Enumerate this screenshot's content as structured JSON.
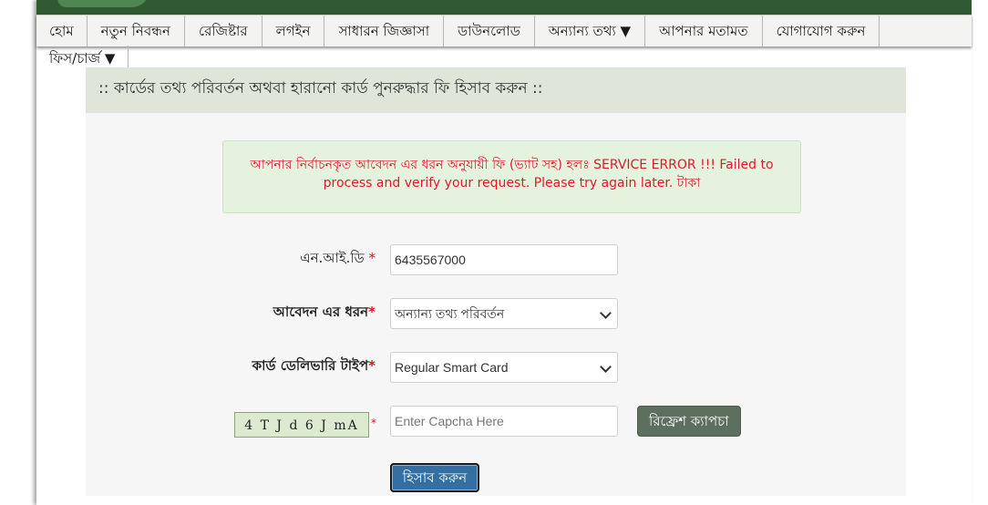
{
  "nav": {
    "items": [
      "হোম",
      "নতুন নিবন্ধন",
      "রেজিষ্টার",
      "লগইন",
      "সাধারন জিজ্ঞাসা",
      "ডাউনলোড",
      "অন্যান্য তথ্য ▼",
      "আপনার মতামত",
      "যোগাযোগ করুন"
    ],
    "row2": [
      "ফিস/চার্জ ▼"
    ]
  },
  "panel": {
    "title": ":: কার্ডের তথ্য পরিবর্তন অথবা হারানো কার্ড পুনরুদ্ধার ফি হিসাব করুন ::"
  },
  "alert": {
    "text": "আপনার নির্বাচনকৃত আবেদন এর ধরন অনুযায়ী ফি (ভ্যাট সহ) হলঃ SERVICE ERROR !!! Failed to process and verify your request. Please try again later. টাকা"
  },
  "form": {
    "nid_label": "এন.আই.ডি",
    "nid_value": "6435567000",
    "app_type_label": "আবেদন এর ধরন",
    "app_type_value": "অন্যান্য তথ্য পরিবর্তন",
    "delivery_label": "কার্ড ডেলিভারি টাইপ",
    "delivery_value": "Regular Smart Card",
    "captcha_text": "4 T J d 6 J mA",
    "captcha_placeholder": "Enter Capcha Here",
    "refresh_label": "রিফ্রেশ ক্যাপচা",
    "submit_label": "হিসাব করুন",
    "required_mark": "*"
  },
  "colors": {
    "header_green": "#2f5a32",
    "panel_title_bg": "#dfe5d8",
    "alert_bg": "#e5f2dd",
    "alert_text": "#e3182a",
    "submit_bg": "#336fa3",
    "refresh_bg": "#5d6f5e"
  }
}
